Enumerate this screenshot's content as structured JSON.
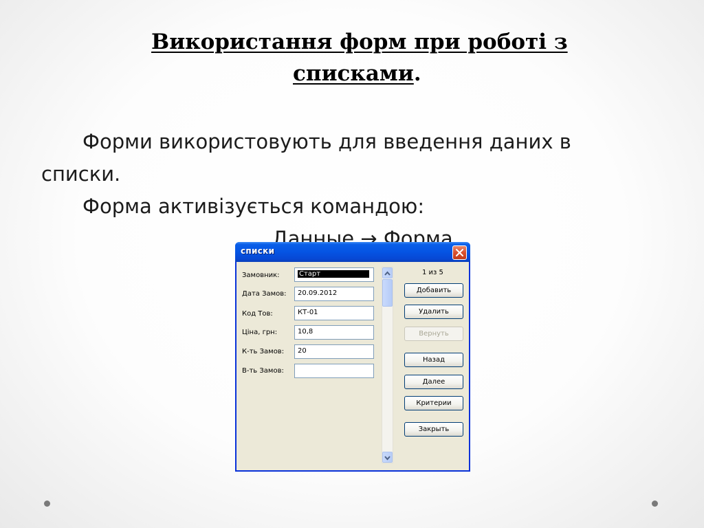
{
  "slide": {
    "title_line1": "Використання форм при роботі з",
    "title_line2": "списками",
    "title_period": ".",
    "text_line1": "Форми використовують для введення даних в",
    "text_line2": "списки.",
    "text_line3": "Форма активізується командою:",
    "text_line4": "Данные → Форма"
  },
  "dialog": {
    "title": "списки",
    "close_label": "✕",
    "record_counter": "1 из 5",
    "fields": [
      {
        "label": "Замовник:",
        "value": "Старт"
      },
      {
        "label": "Дата Замов:",
        "value": "20.09.2012"
      },
      {
        "label": "Код Тов:",
        "value": "КТ-01"
      },
      {
        "label": "Ціна, грн:",
        "value": "10,8"
      },
      {
        "label": "К-ть Замов:",
        "value": "20"
      },
      {
        "label": "В-ть Замов:",
        "value": ""
      }
    ],
    "buttons": {
      "add": "Добавить",
      "delete": "Удалить",
      "restore": "Вернуть",
      "prev": "Назад",
      "next": "Далее",
      "criteria": "Критерии",
      "close": "Закрыть"
    }
  },
  "colors": {
    "titlebar": "#0554e3",
    "dialog_bg": "#ece9d8",
    "close_button": "#d8502e"
  }
}
